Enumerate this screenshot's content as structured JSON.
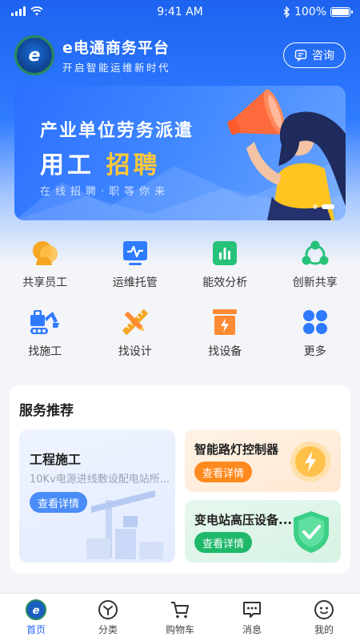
{
  "status_bar": {
    "time": "9:41 AM",
    "battery": "100%",
    "battery_level": 1.0
  },
  "header": {
    "title": "e电通商务平台",
    "slogan": "开启智能运维新时代",
    "consult_label": "咨询",
    "logo_text": "e"
  },
  "banner": {
    "line1": "产业单位劳务派遣",
    "line2_a": "用工",
    "line2_b": "招聘",
    "line3": "在线招聘·职等你来",
    "slides": 2,
    "active_slide": 2
  },
  "categories": [
    {
      "label": "共享员工",
      "icon": "shared-staff-icon",
      "color": "#f5a623"
    },
    {
      "label": "运维托管",
      "icon": "monitor-pulse-icon",
      "color": "#2f7bff"
    },
    {
      "label": "能效分析",
      "icon": "bar-chart-icon",
      "color": "#27c27a"
    },
    {
      "label": "创新共享",
      "icon": "share-network-icon",
      "color": "#27c27a"
    },
    {
      "label": "找施工",
      "icon": "excavator-icon",
      "color": "#2f7bff"
    },
    {
      "label": "找设计",
      "icon": "pencil-ruler-icon",
      "color": "#f5a623"
    },
    {
      "label": "找设备",
      "icon": "power-box-icon",
      "color": "#ff8a34"
    },
    {
      "label": "更多",
      "icon": "more-grid-icon",
      "color": "#2f7bff"
    }
  ],
  "services": {
    "title": "服务推荐",
    "cards": [
      {
        "title": "工程施工",
        "subtitle": "10Kv电源进线敷设配电站所...",
        "button": "查看详情",
        "accent": "#4b8df8"
      },
      {
        "title": "智能路灯控制器",
        "button": "查看详情",
        "accent": "#ff8a1f"
      },
      {
        "title": "变电站高压设备...",
        "button": "查看详情",
        "accent": "#1fb86a"
      }
    ]
  },
  "tabbar": [
    {
      "label": "首页",
      "icon": "home-logo-icon",
      "active": true
    },
    {
      "label": "分类",
      "icon": "category-icon",
      "active": false
    },
    {
      "label": "购物车",
      "icon": "cart-icon",
      "active": false
    },
    {
      "label": "消息",
      "icon": "message-icon",
      "active": false
    },
    {
      "label": "我的",
      "icon": "profile-icon",
      "active": false
    }
  ]
}
